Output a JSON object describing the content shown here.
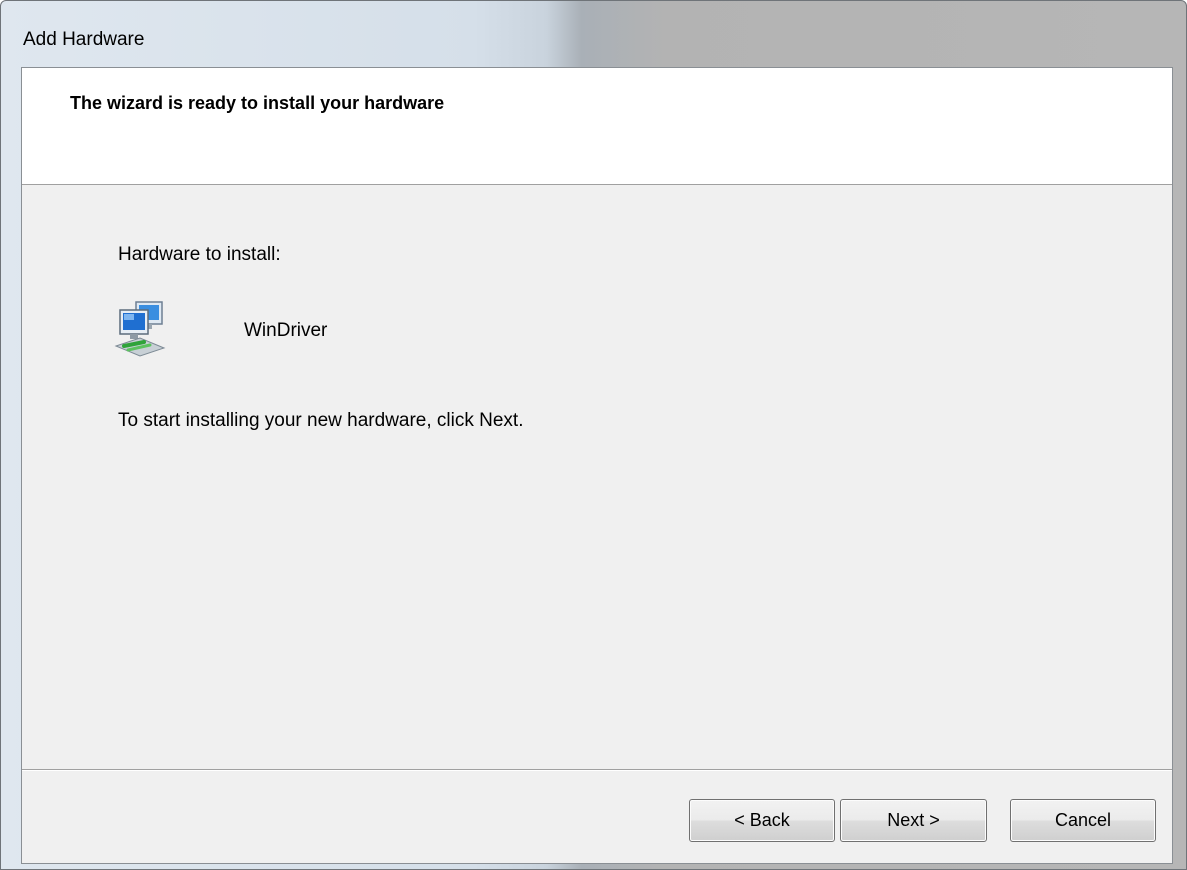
{
  "window": {
    "title": "Add Hardware"
  },
  "header": {
    "title": "The wizard is ready to install your hardware"
  },
  "content": {
    "hardware_label": "Hardware to install:",
    "device_name": "WinDriver",
    "device_icon": "network-device-icon",
    "instruction": "To start installing your new hardware, click Next."
  },
  "buttons": {
    "back": "< Back",
    "next": "Next >",
    "cancel": "Cancel"
  }
}
